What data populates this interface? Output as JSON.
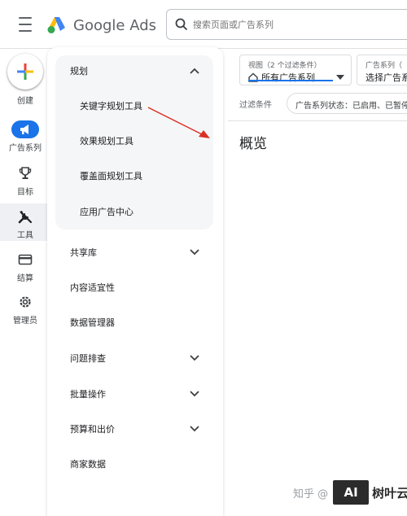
{
  "header": {
    "logo_text": "Google Ads",
    "search_placeholder": "搜索页面或广告系列"
  },
  "rail": {
    "create_label": "创建",
    "items": [
      {
        "label": "广告系列",
        "icon": "megaphone-icon"
      },
      {
        "label": "目标",
        "icon": "trophy-icon"
      },
      {
        "label": "工具",
        "icon": "tools-icon"
      },
      {
        "label": "结算",
        "icon": "credit-card-icon"
      },
      {
        "label": "管理员",
        "icon": "gear-icon"
      }
    ]
  },
  "panel": {
    "planning": {
      "title": "规划",
      "items": [
        "关键字规划工具",
        "效果规划工具",
        "覆盖面规划工具",
        "应用广告中心"
      ]
    },
    "sections": [
      {
        "label": "共享库",
        "expandable": true
      },
      {
        "label": "内容适宜性",
        "expandable": false
      },
      {
        "label": "数据管理器",
        "expandable": false
      },
      {
        "label": "问题排查",
        "expandable": true
      },
      {
        "label": "批量操作",
        "expandable": true
      },
      {
        "label": "预算和出价",
        "expandable": true
      },
      {
        "label": "商家数据",
        "expandable": false
      }
    ]
  },
  "main": {
    "view_small": "视图（2 个过滤条件）",
    "view_value": "所有广告系列",
    "campaign_small": "广告系列（",
    "campaign_value": "选择广告系",
    "filter_label": "过滤条件",
    "filter_chip": "广告系列状态：已启用、已暂停",
    "page_title": "概览"
  },
  "watermark": {
    "text": "知乎 @",
    "box": "AI",
    "brand": "树叶云"
  },
  "colors": {
    "accent": "#1a73e8",
    "arrow": "#d93025"
  }
}
